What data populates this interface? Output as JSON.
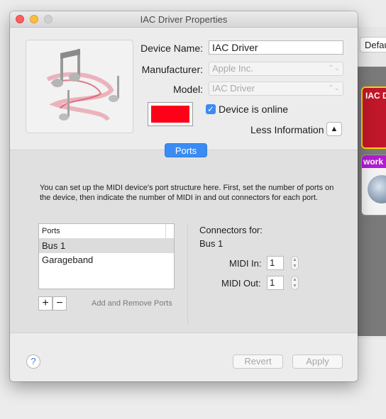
{
  "window": {
    "title": "IAC Driver Properties"
  },
  "background": {
    "toolbar_popup": "Defau",
    "device_red_label": "IAC D",
    "device_network_label": "work"
  },
  "properties": {
    "device_name_label": "Device Name:",
    "device_name_value": "IAC Driver",
    "manufacturer_label": "Manufacturer:",
    "manufacturer_value": "Apple Inc.",
    "model_label": "Model:",
    "model_value": "IAC Driver",
    "online_label": "Device is online",
    "online_checked": true,
    "device_color": "#ff0019",
    "less_info_label": "Less Information"
  },
  "ports_tab": {
    "label": "Ports"
  },
  "description": "You can set up the MIDI device's port structure here.  First, set the number of ports on the device, then indicate the number of MIDI in and out connectors for each port.",
  "ports": {
    "header": "Ports",
    "items": [
      "Bus 1",
      "Garageband"
    ],
    "selected_index": 0,
    "add_remove_label": "Add and Remove Ports"
  },
  "connectors": {
    "title": "Connectors for:",
    "port_name": "Bus 1",
    "midi_in_label": "MIDI In:",
    "midi_in_value": "1",
    "midi_out_label": "MIDI Out:",
    "midi_out_value": "1"
  },
  "footer": {
    "help_label": "?",
    "revert_label": "Revert",
    "apply_label": "Apply"
  }
}
